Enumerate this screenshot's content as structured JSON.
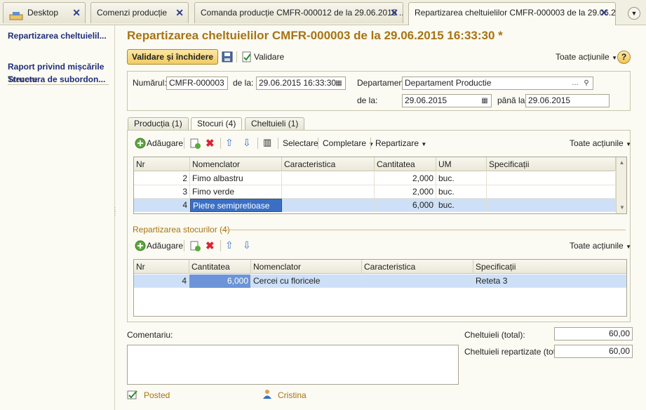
{
  "tabs": [
    {
      "label": "Desktop"
    },
    {
      "label": "Comenzi producție"
    },
    {
      "label": "Comanda producție CMFR-000012 de la 29.06.2015 ..."
    },
    {
      "label": "Repartizarea cheltuielilor CMFR-000003 de la 29.06.2..."
    }
  ],
  "sidebar": {
    "current": "Repartizarea cheltuielil...",
    "section": "Trecere",
    "links": [
      "Raport privind mișcările",
      "Structura de subordon..."
    ]
  },
  "form": {
    "title": "Repartizarea cheltuielilor CMFR-000003 de la 29.06.2015 16:33:30 *",
    "btn_save_close": "Validare și închidere",
    "btn_post": "Validare",
    "all_actions": "Toate acțiunile",
    "help": "?",
    "number_label": "Numărul:",
    "number_value": "CMFR-000003",
    "date_label": "de la:",
    "date_value": "29.06.2015 16:33:30",
    "dept_label": "Departament:",
    "dept_value": "Departament Productie",
    "from_label": "de la:",
    "from_value": "29.06.2015",
    "to_label": "până la:",
    "to_value": "29.06.2015"
  },
  "subtabs": [
    "Producția (1)",
    "Stocuri (4)",
    "Cheltuieli (1)"
  ],
  "stocks": {
    "toolbar": {
      "add": "Adăugare",
      "select": "Selectare",
      "complete": "Completare",
      "distribute": "Repartizare",
      "all_actions": "Toate acțiunile"
    },
    "headers": [
      "Nr",
      "Nomenclator",
      "Caracteristica",
      "Cantitatea",
      "UM",
      "Specificații"
    ],
    "rows": [
      {
        "nr": "2",
        "item": "Fimo albastru",
        "char": "",
        "qty": "2,000",
        "um": "buc.",
        "spec": ""
      },
      {
        "nr": "3",
        "item": "Fimo verde",
        "char": "",
        "qty": "2,000",
        "um": "buc.",
        "spec": ""
      },
      {
        "nr": "4",
        "item": "Pietre semipretioase",
        "char": "",
        "qty": "6,000",
        "um": "buc.",
        "spec": ""
      }
    ]
  },
  "distribution": {
    "section_title": "Repartizarea stocurilor (4)",
    "toolbar": {
      "add": "Adăugare",
      "all_actions": "Toate acțiunile"
    },
    "headers": [
      "Nr",
      "Cantitatea",
      "Nomenclator",
      "Caracteristica",
      "Specificații"
    ],
    "rows": [
      {
        "nr": "4",
        "qty": "6,000",
        "item": "Cercei cu floricele",
        "char": "",
        "spec": "Reteta 3"
      }
    ]
  },
  "footer": {
    "comment_label": "Comentariu:",
    "comment_value": "",
    "total_label": "Cheltuieli (total):",
    "total_value": "60,00",
    "distributed_label": "Cheltuieli repartizate (total):",
    "distributed_value": "60,00",
    "status": "Posted",
    "user": "Cristina"
  },
  "colors": {
    "title": "#a77412",
    "link": "#1d2e7a",
    "selection": "#cde0f7"
  }
}
